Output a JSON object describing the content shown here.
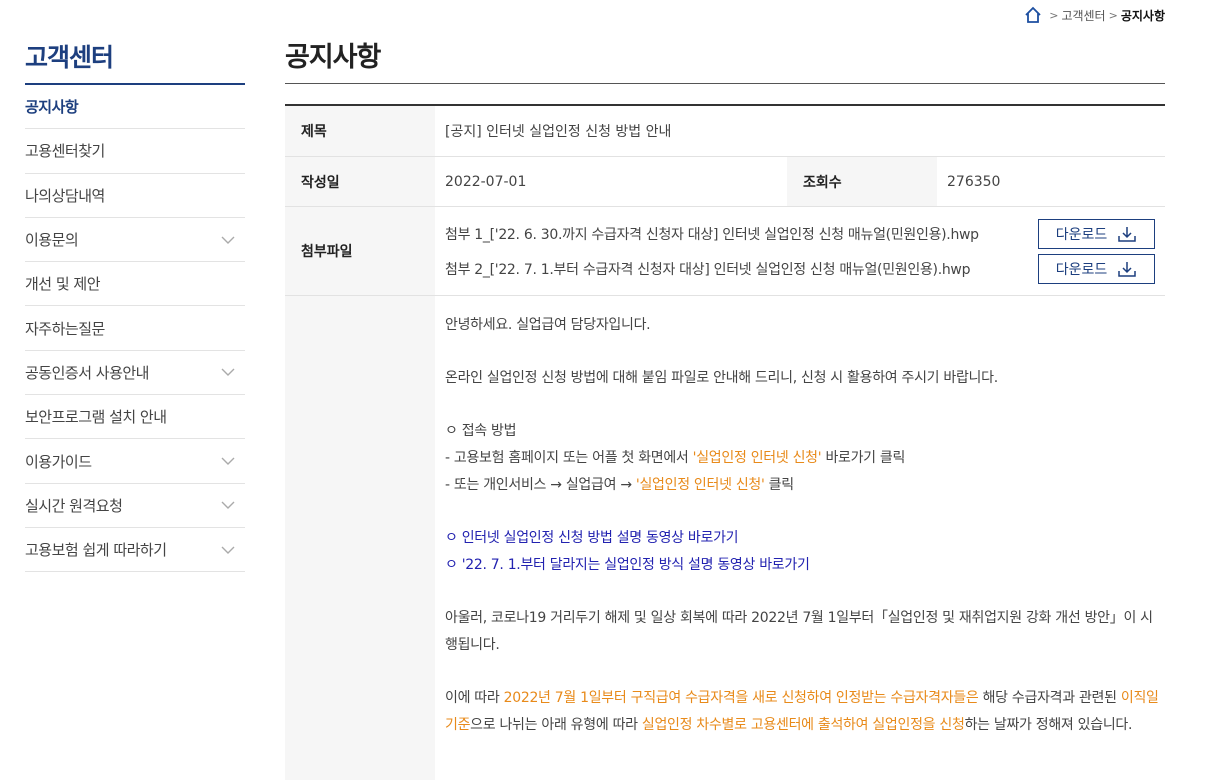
{
  "breadcrumb": {
    "items": [
      "고객센터"
    ],
    "current": "공지사항"
  },
  "sidebar": {
    "title": "고객센터",
    "items": [
      {
        "label": "공지사항",
        "active": true,
        "expandable": false
      },
      {
        "label": "고용센터찾기",
        "expandable": false
      },
      {
        "label": "나의상담내역",
        "expandable": false
      },
      {
        "label": "이용문의",
        "expandable": true
      },
      {
        "label": "개선 및 제안",
        "expandable": false
      },
      {
        "label": "자주하는질문",
        "expandable": false
      },
      {
        "label": "공동인증서 사용안내",
        "expandable": true
      },
      {
        "label": "보안프로그램 설치 안내",
        "expandable": false
      },
      {
        "label": "이용가이드",
        "expandable": true
      },
      {
        "label": "실시간 원격요청",
        "expandable": true
      },
      {
        "label": "고용보험 쉽게 따라하기",
        "expandable": true
      }
    ]
  },
  "page": {
    "title": "공지사항"
  },
  "notice": {
    "title_label": "제목",
    "title": "[공지] 인터넷 실업인정 신청 방법 안내",
    "date_label": "작성일",
    "date": "2022-07-01",
    "views_label": "조회수",
    "views": "276350",
    "attach_label": "첨부파일",
    "attachments": [
      "첨부 1_['22. 6. 30.까지 수급자격 신청자 대상] 인터넷 실업인정 신청 매뉴얼(민원인용).hwp",
      "첨부 2_['22. 7. 1.부터 수급자격 신청자 대상] 인터넷 실업인정 신청 매뉴얼(민원인용).hwp"
    ],
    "download_label": "다운로드"
  },
  "body": {
    "greeting": "안녕하세요. 실업급여 담당자입니다.",
    "intro": "온라인 실업인정 신청 방법에 대해 붙임 파일로 안내해 드리니, 신청 시 활용하여 주시기 바랍니다.",
    "access_heading": "ㅇ  접속 방법",
    "access1_a": "- 고용보험 홈페이지 또는 어플 첫 화면에서 ",
    "access1_b": "'실업인정 인터넷 신청'",
    "access1_c": " 바로가기 클릭",
    "access2_a": "- 또는 개인서비스 → 실업급여 → ",
    "access2_b": "'실업인정 인터넷 신청'",
    "access2_c": " 클릭",
    "link1": " ㅇ 인터넷 실업인정 신청 방법 설명 동영상 바로가기",
    "link2": " ㅇ '22. 7. 1.부터 달라지는 실업인정 방식 설명 동영상 바로가기",
    "para3": "아울러, 코로나19 거리두기 해제 및 일상 회복에 따라 2022년 7월 1일부터「실업인정 및 재취업지원 강화 개선 방안」이 시행됩니다.",
    "para4_a": "이에 따라 ",
    "para4_b": "2022년 7월 1일부터 구직급여 수급자격을 새로 신청하여 인정받는 수급자격자들은",
    "para4_c": " 해당 수급자격과 관련된 ",
    "para4_d": "이직일 기준",
    "para4_e": "으로 나뉘는 아래 유형에 따라 ",
    "para4_f": "실업인정 차수별로 고용센터에 출석하여 실업인정을 신청",
    "para4_g": "하는 날짜가 정해져 있습니다."
  }
}
